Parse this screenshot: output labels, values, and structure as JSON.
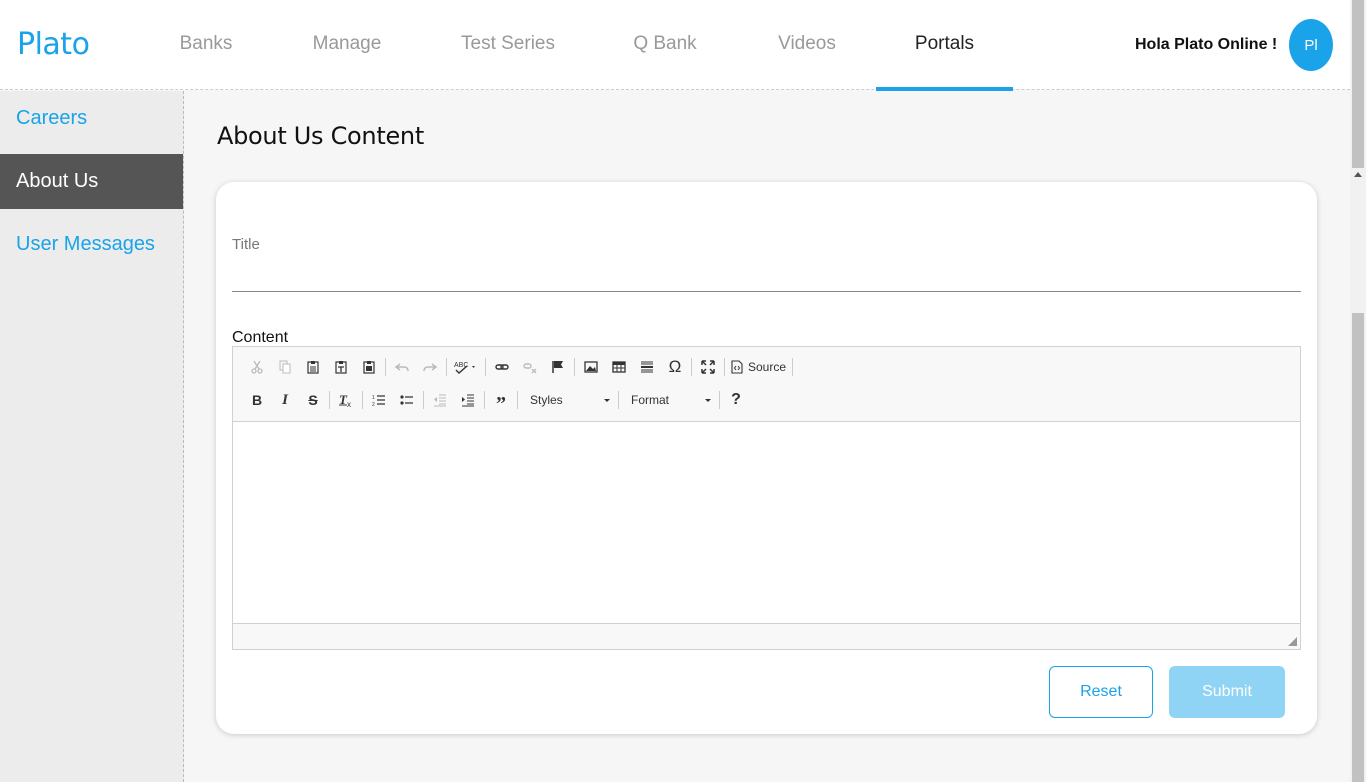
{
  "app": {
    "logo": "Plato"
  },
  "nav": {
    "tabs": [
      {
        "label": "Banks"
      },
      {
        "label": "Manage"
      },
      {
        "label": "Test Series"
      },
      {
        "label": "Q Bank"
      },
      {
        "label": "Videos"
      },
      {
        "label": "Portals"
      }
    ],
    "active_tab": "Portals"
  },
  "user": {
    "greeting": "Hola Plato Online !",
    "avatar_initials": "Pl"
  },
  "sidebar": {
    "items": [
      {
        "label": "Careers"
      },
      {
        "label": "About Us"
      },
      {
        "label": "User Messages"
      }
    ],
    "active_item": "About Us"
  },
  "page": {
    "title": "About Us Content"
  },
  "form": {
    "title_label": "Title",
    "title_value": "",
    "content_label": "Content",
    "editor": {
      "source_label": "Source",
      "styles_label": "Styles",
      "format_label": "Format",
      "content": ""
    },
    "reset_label": "Reset",
    "submit_label": "Submit"
  },
  "colors": {
    "accent": "#1aa3e8",
    "submit_disabled": "#8fd4f4",
    "sidebar_active": "#555555"
  }
}
